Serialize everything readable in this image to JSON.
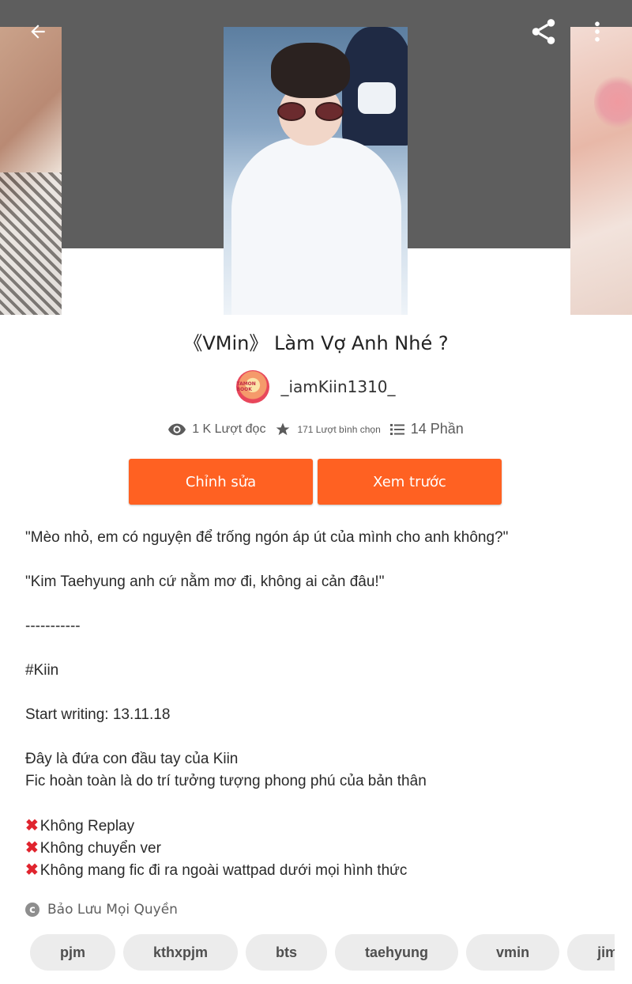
{
  "header": {
    "back_icon": "arrow-left-icon",
    "share_icon": "share-icon",
    "more_icon": "more-vertical-icon"
  },
  "story": {
    "title": "《VMin》 Làm Vợ Anh Nhé ?",
    "author": "_iamKiin1310_",
    "avatar_text": "TAMON BOOK",
    "reads": "1 K Lượt đọc",
    "votes": "171 Lượt bình chọn",
    "parts": "14 Phần"
  },
  "actions": {
    "edit_label": "Chỉnh sửa",
    "preview_label": "Xem trước"
  },
  "description": {
    "line1": "\"Mèo nhỏ, em có nguyện để trống ngón áp út của mình cho anh không?\"",
    "line2": "\"Kim Taehyung anh cứ nằm mơ đi, không ai cản đâu!\"",
    "line3": "-----------",
    "line4": "#Kiin",
    "line5": "Start writing: 13.11.18",
    "line6": "Đây là đứa con đầu tay của Kiin",
    "line7": "Fic hoàn toàn là do trí tưởng tượng phong phú của bản thân",
    "rule1": "Không Replay",
    "rule2": "Không chuyển ver",
    "rule3": "Không mang fic đi ra ngoài wattpad dưới mọi hình thức"
  },
  "copyright": {
    "icon": "copyright-icon",
    "text": "Bảo Lưu Mọi Quyền"
  },
  "tags": [
    "pjm",
    "kthxpjm",
    "bts",
    "taehyung",
    "vmin",
    "jimin",
    ""
  ],
  "colors": {
    "accent": "#ff6122",
    "header_bg": "#5e5e5e",
    "tag_bg": "#ececec",
    "xmark": "#e0242e"
  }
}
